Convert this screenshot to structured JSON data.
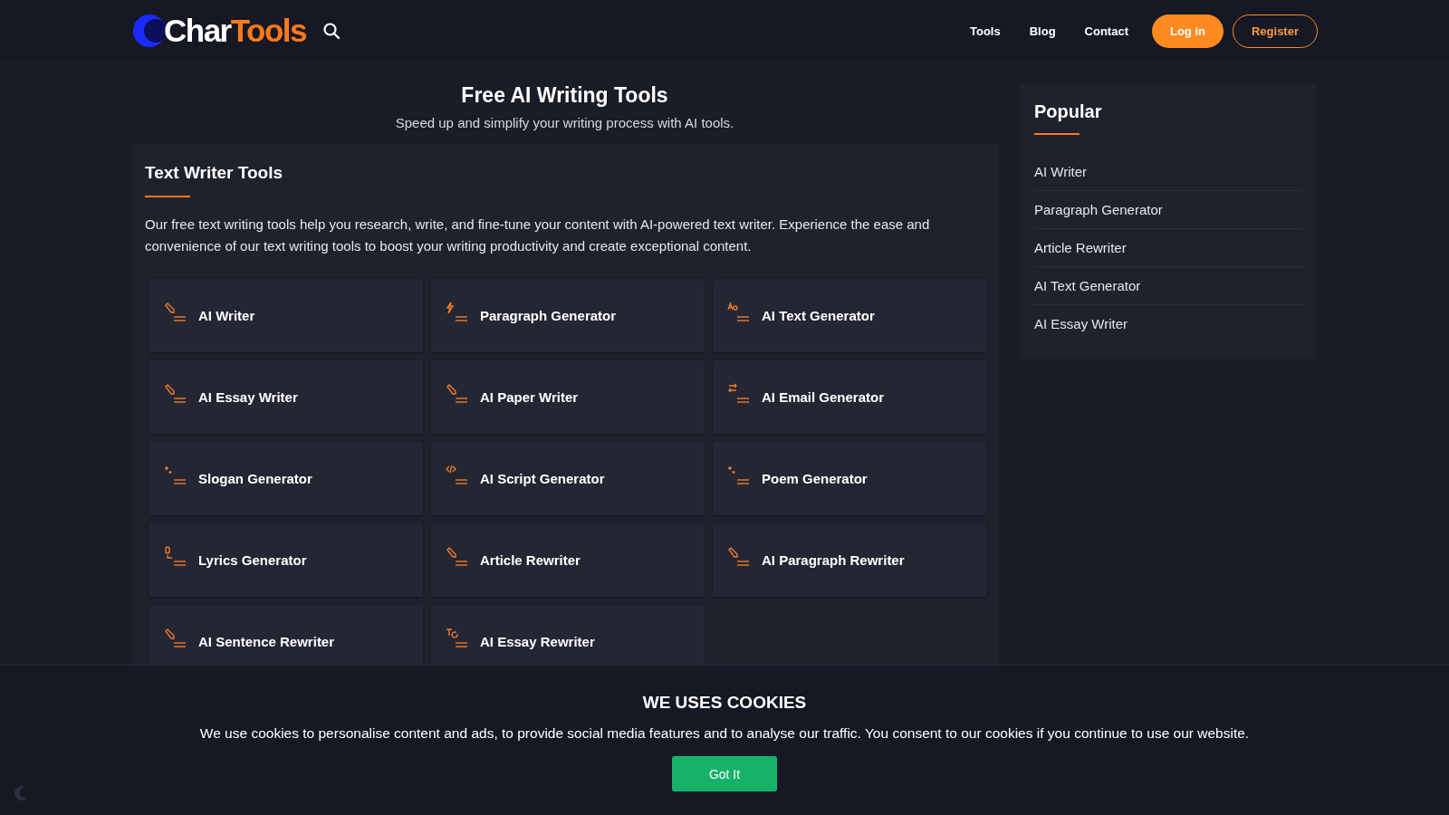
{
  "header": {
    "logo": {
      "part_1": "Char",
      "part_2": "Tools"
    },
    "nav": [
      "Tools",
      "Blog",
      "Contact"
    ],
    "login": "Log in",
    "register": "Register"
  },
  "hero": {
    "title": "Free AI Writing Tools",
    "subtitle": "Speed up and simplify your writing process with AI tools."
  },
  "section": {
    "title": "Text Writer Tools",
    "description": "Our free text writing tools help you research, write, and fine-tune your content with AI-powered text writer. Experience the ease and convenience of our text writing tools to boost your writing productivity and create exceptional content.",
    "tools": [
      "AI Writer",
      "Paragraph Generator",
      "AI Text Generator",
      "AI Essay Writer",
      "AI Paper Writer",
      "AI Email Generator",
      "Slogan Generator",
      "AI Script Generator",
      "Poem Generator",
      "Lyrics Generator",
      "Article Rewriter",
      "AI Paragraph Rewriter",
      "AI Sentence Rewriter",
      "AI Essay Rewriter"
    ]
  },
  "sidebar": {
    "title": "Popular",
    "items": [
      "AI Writer",
      "Paragraph Generator",
      "Article Rewriter",
      "AI Text Generator",
      "AI Essay Writer"
    ]
  },
  "cookie_banner": {
    "title": "WE USES COOKIES",
    "text": "We use cookies to personalise content and ads, to provide social media features and to analyse our traffic. You consent to our cookies if you continue to use our website.",
    "button": "Got It"
  }
}
